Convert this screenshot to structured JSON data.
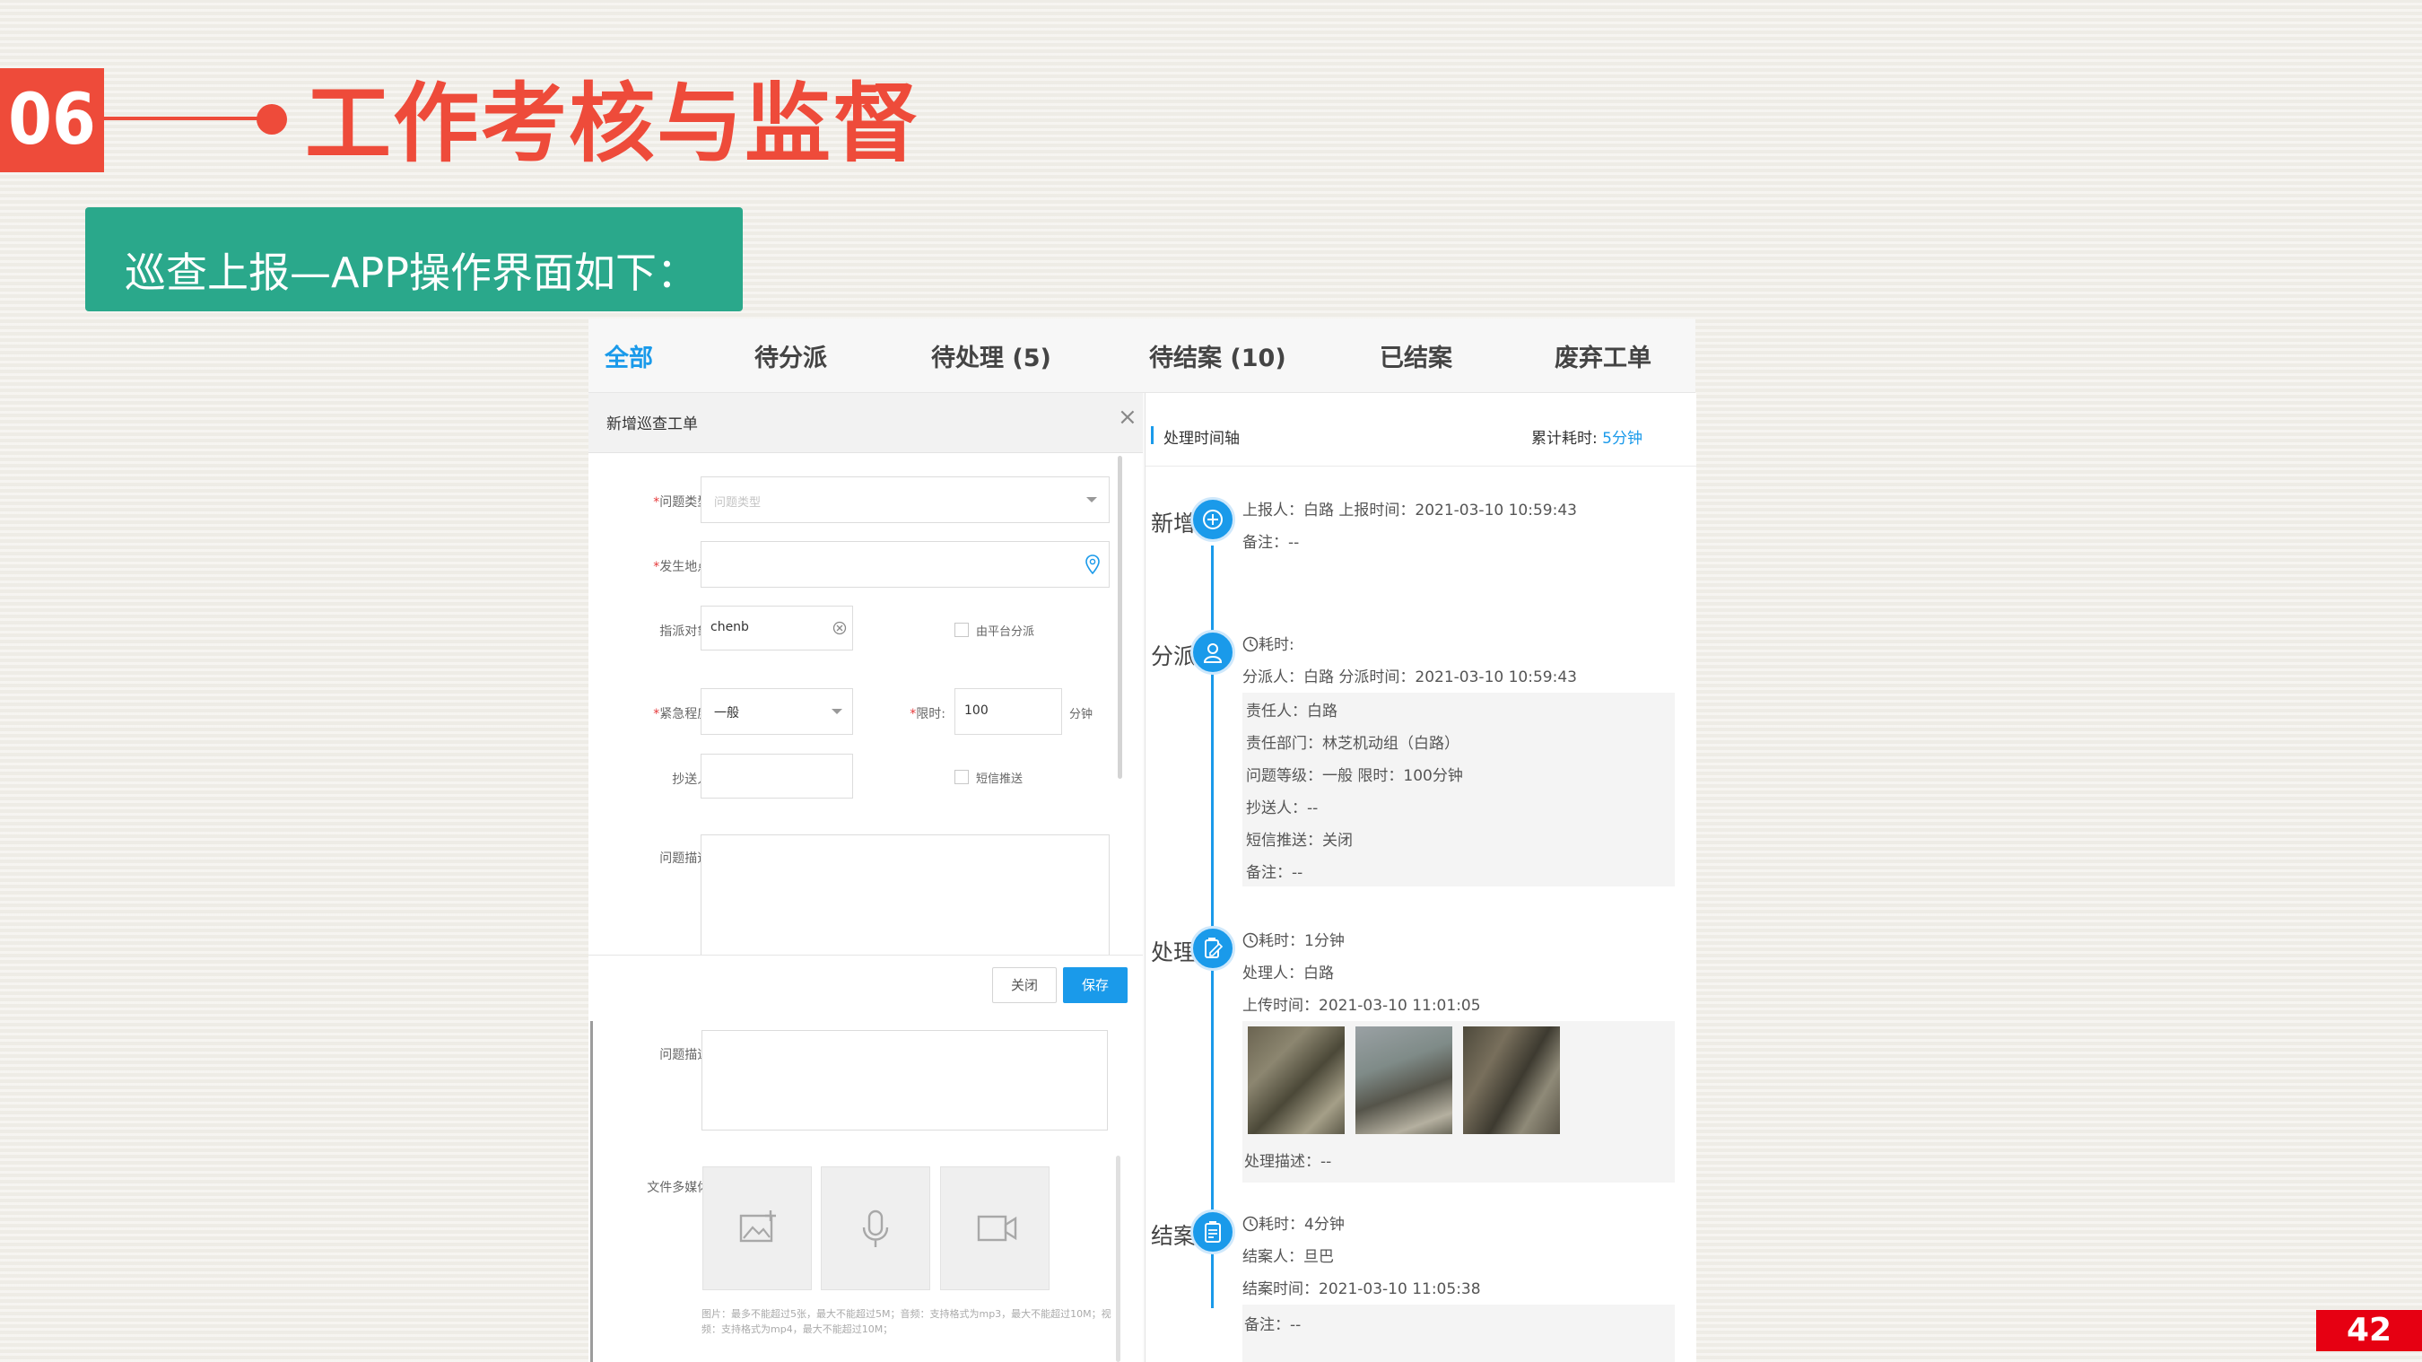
{
  "slide": {
    "section_number": "06",
    "title": "工作考核与监督",
    "subtitle": "巡查上报—APP操作界面如下：",
    "page_number": "42"
  },
  "tabs": [
    {
      "label": "全部",
      "active": true
    },
    {
      "label": "待分派"
    },
    {
      "label": "待处理 (5)"
    },
    {
      "label": "待结案 (10)"
    },
    {
      "label": "已结案"
    },
    {
      "label": "废弃工单"
    }
  ],
  "form": {
    "title": "新增巡查工单",
    "close_icon": "close-icon",
    "problem_type": {
      "label": "问题类型:",
      "placeholder": "问题类型"
    },
    "location": {
      "label": "发生地点:",
      "value": ""
    },
    "assignee": {
      "label": "指派对象:",
      "value": "chenb"
    },
    "platform_assign": {
      "label": "由平台分派"
    },
    "urgency": {
      "label": "紧急程度:",
      "value": "一般"
    },
    "time_limit": {
      "label": "限时:",
      "value": "100",
      "unit": "分钟"
    },
    "cc": {
      "label": "抄送人:",
      "value": ""
    },
    "sms_push": {
      "label": "短信推送"
    },
    "description": {
      "label": "问题描述:"
    },
    "buttons": {
      "close": "关闭",
      "save": "保存"
    },
    "description2": {
      "label": "问题描述:"
    },
    "media": {
      "label": "文件多媒体:",
      "note": "图片：最多不能超过5张，最大不能超过5M；音频：支持格式为mp3，最大不能超过10M；视频：支持格式为mp4，最大不能超过10M；"
    }
  },
  "timeline": {
    "header": "处理时间轴",
    "total_label": "累计耗时:",
    "total_value": "5分钟",
    "stages": {
      "new": {
        "name": "新增",
        "reporter": "上报人：白路   上报时间：2021-03-10 10:59:43",
        "remark": "备注：--"
      },
      "assign": {
        "name": "分派",
        "duration": "耗时:",
        "assigner": "分派人：白路   分派时间：2021-03-10 10:59:43",
        "details": [
          "责任人：白路",
          "责任部门：林芝机动组（白路）",
          "问题等级：一般   限时：100分钟",
          "抄送人：--",
          "短信推送：关闭",
          "备注：--"
        ]
      },
      "process": {
        "name": "处理",
        "duration": "耗时：1分钟",
        "handler": "处理人：白路",
        "upload_time": "上传时间：2021-03-10 11:01:05",
        "description": "处理描述：--"
      },
      "close": {
        "name": "结案",
        "duration": "耗时：4分钟",
        "closer": "结案人：旦巴",
        "close_time": "结案时间：2021-03-10 11:05:38",
        "remark": "备注：--"
      }
    }
  },
  "colors": {
    "accent": "#ee4b3a",
    "banner": "#2aa88b",
    "app_blue": "#1a9aea",
    "page_badge": "#e60012"
  }
}
